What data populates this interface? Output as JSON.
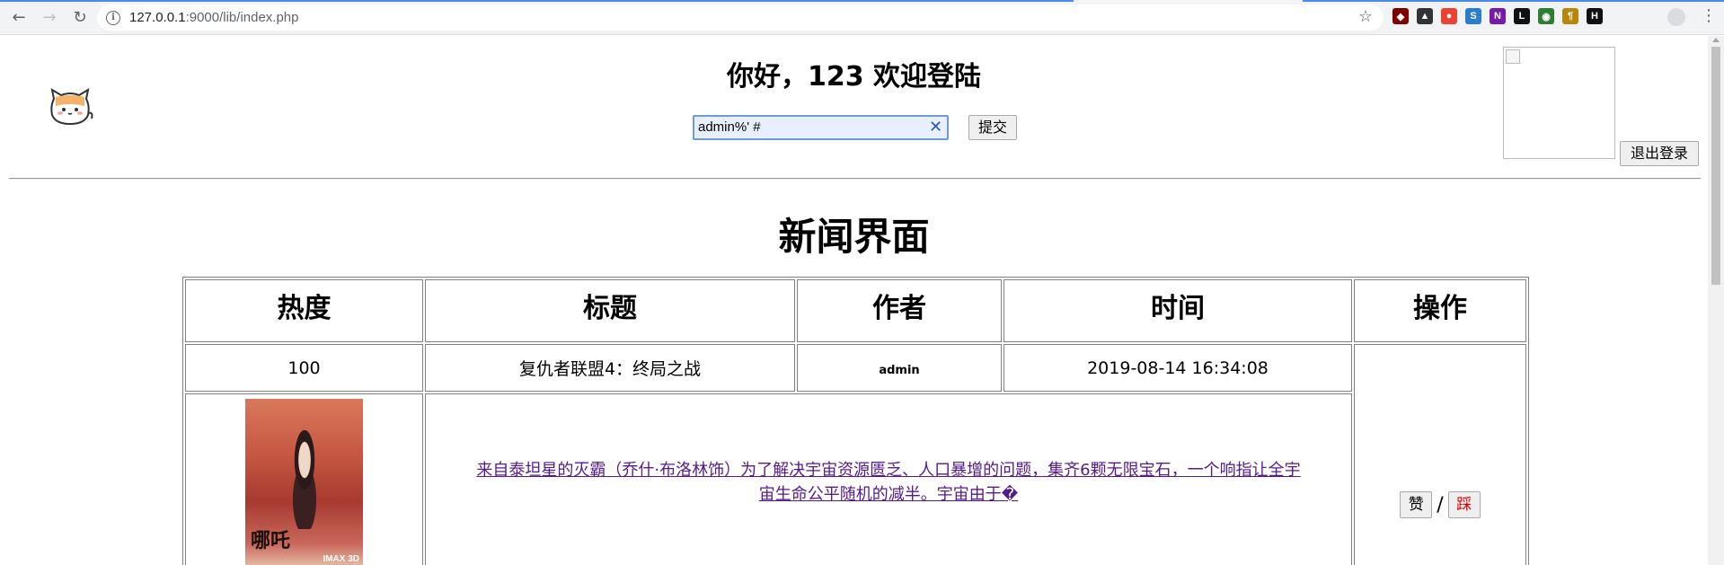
{
  "browser": {
    "url_host": "127.0.0.1",
    "url_rest": ":9000/lib/index.php",
    "extensions": [
      {
        "icon": "ublock-icon",
        "color": "#800000",
        "glyph": "◆"
      },
      {
        "icon": "mask-icon",
        "color": "#333333",
        "glyph": "▲"
      },
      {
        "icon": "chrome-color-icon",
        "color": "#ea4335",
        "glyph": "●"
      },
      {
        "icon": "s-icon",
        "color": "#2b7cd3",
        "glyph": "S"
      },
      {
        "icon": "onenote-icon",
        "color": "#7719aa",
        "glyph": "N"
      },
      {
        "icon": "l-icon",
        "color": "#111111",
        "glyph": "L"
      },
      {
        "icon": "globe-icon",
        "color": "#2e7d32",
        "glyph": "◉"
      },
      {
        "icon": "translate-icon",
        "color": "#b8860b",
        "glyph": "¶"
      },
      {
        "icon": "h-icon",
        "color": "#111111",
        "glyph": "H"
      }
    ]
  },
  "header": {
    "greeting": "你好，123 欢迎登陆",
    "search_value": "admin%' #",
    "submit_label": "提交",
    "logout_label": "退出登录"
  },
  "main": {
    "title": "新闻界面",
    "columns": [
      "热度",
      "标题",
      "作者",
      "时间",
      "操作"
    ],
    "row": {
      "heat": "100",
      "title": "复仇者联盟4：终局之战",
      "author": "admin",
      "time": "2019-08-14 16:34:08",
      "summary_line1": "来自泰坦星的灭霸（乔什·布洛林饰）为了解决宇宙资源匮乏、人口暴增的问题，集齐6颗无限宝石，一个响指让全宇",
      "summary_line2": "宙生命公平随机的减半。宇宙由于�",
      "like_label": "赞",
      "dislike_label": "踩",
      "separator": "/",
      "poster_badge": "IMAX 3D"
    }
  }
}
